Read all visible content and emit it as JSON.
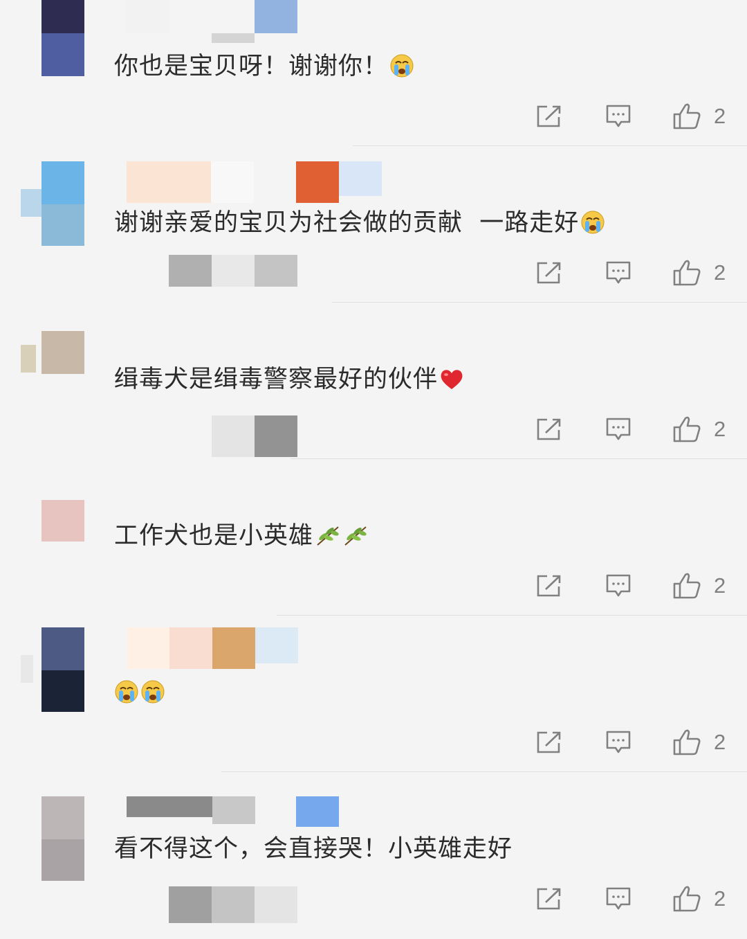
{
  "comments": [
    {
      "text": "你也是宝贝呀！谢谢你！",
      "emojis": [
        "crying-face"
      ],
      "repost_icon": "share-icon",
      "reply_icon": "comment-icon",
      "like_icon": "thumbs-up-icon",
      "likes": "2"
    },
    {
      "text": "谢谢亲爱的宝贝为社会做的贡献  一路走好",
      "emojis": [
        "crying-face"
      ],
      "repost_icon": "share-icon",
      "reply_icon": "comment-icon",
      "like_icon": "thumbs-up-icon",
      "likes": "2"
    },
    {
      "text": "缉毒犬是缉毒警察最好的伙伴",
      "emojis": [
        "red-heart"
      ],
      "repost_icon": "share-icon",
      "reply_icon": "comment-icon",
      "like_icon": "thumbs-up-icon",
      "likes": "2"
    },
    {
      "text": "工作犬也是小英雄",
      "emojis": [
        "olive-branch",
        "olive-branch"
      ],
      "repost_icon": "share-icon",
      "reply_icon": "comment-icon",
      "like_icon": "thumbs-up-icon",
      "likes": "2"
    },
    {
      "text": "",
      "emojis": [
        "crying-face",
        "crying-face"
      ],
      "repost_icon": "share-icon",
      "reply_icon": "comment-icon",
      "like_icon": "thumbs-up-icon",
      "likes": "2"
    },
    {
      "text": "看不得这个，会直接哭！小英雄走好",
      "emojis": [],
      "repost_icon": "share-icon",
      "reply_icon": "comment-icon",
      "like_icon": "thumbs-up-icon",
      "likes": "2"
    }
  ],
  "colors": {
    "background": "#f4f4f4",
    "text": "#2b2b2b",
    "icon": "#808080",
    "divider": "#e0e0e0"
  }
}
